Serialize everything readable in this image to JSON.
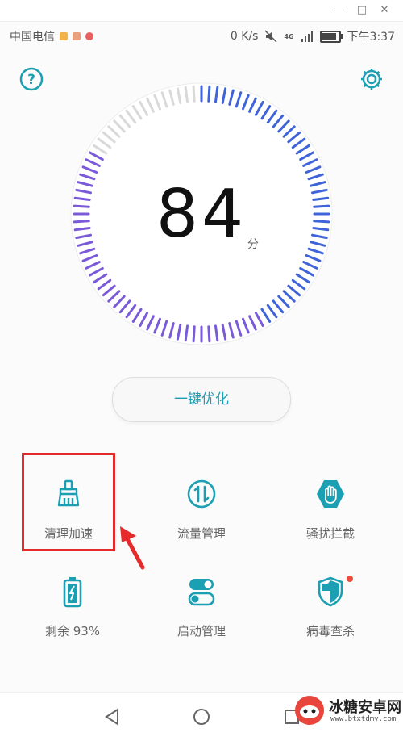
{
  "status": {
    "carrier": "中国电信",
    "speed": "0 K/s",
    "network": "4G",
    "time": "下午3:37",
    "battery_level": 0.93
  },
  "header": {
    "help_icon": "help-circle-icon",
    "settings_icon": "gear-icon"
  },
  "score": {
    "value": "84",
    "unit": "分",
    "fraction": 0.84
  },
  "optimize_button": "一键优化",
  "grid": [
    {
      "label": "清理加速",
      "icon": "broom-icon"
    },
    {
      "label": "流量管理",
      "icon": "data-traffic-icon"
    },
    {
      "label": "骚扰拦截",
      "icon": "hand-block-icon"
    },
    {
      "label": "剩余 93%",
      "icon": "battery-icon"
    },
    {
      "label": "启动管理",
      "icon": "toggle-icon"
    },
    {
      "label": "病毒查杀",
      "icon": "shield-icon"
    }
  ],
  "watermark": {
    "text": "冰糖安卓网",
    "url": "www.btxtdmy.com"
  },
  "colors": {
    "accent": "#1b9fb2",
    "gauge_blue": "#3f63d8",
    "gauge_purple": "#7a5ad8",
    "gauge_grey": "#d9d9d9",
    "highlight": "#e42a2a"
  }
}
